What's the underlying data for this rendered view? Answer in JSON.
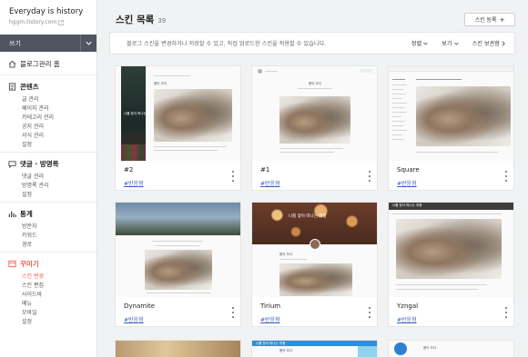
{
  "blog": {
    "title": "Everyday is history",
    "url": "hggm.tistory.com"
  },
  "sidebar": {
    "write_label": "쓰기",
    "home_label": "블로그관리 홈",
    "sections": [
      {
        "title": "콘텐츠",
        "items": [
          "글 관리",
          "페이지 관리",
          "카테고리 관리",
          "공지 관리",
          "서식 관리",
          "설정"
        ]
      },
      {
        "title": "댓글 · 방명록",
        "items": [
          "댓글 관리",
          "방명록 관리",
          "설정"
        ]
      },
      {
        "title": "통계",
        "items": [
          "방문자",
          "키워드",
          "경로"
        ]
      },
      {
        "title": "꾸미기",
        "items": [
          "스킨 변경",
          "스킨 편집",
          "사이드바",
          "메뉴",
          "모바일",
          "설정"
        ]
      }
    ]
  },
  "header": {
    "title": "스킨 목록",
    "count": "39",
    "register_label": "스킨 등록"
  },
  "notice": {
    "text": "블로그 스킨을 변경하거나 저장할 수 있고, 직접 업로드한 스킨을 적용할 수 있습니다.",
    "sort_label": "정렬",
    "view_label": "보기",
    "storage_label": "스킨 보관함"
  },
  "cards": [
    {
      "name": "#2",
      "tag": "#반응형",
      "thumb_title": "나를 찾아 떠나는 여행",
      "thumb_heading": "봄이 오다"
    },
    {
      "name": "#1",
      "tag": "#반응형",
      "thumb_heading": "봄이 오다"
    },
    {
      "name": "Square",
      "tag": "#반응형"
    },
    {
      "name": "Dynamite",
      "tag": "#반응형"
    },
    {
      "name": "Tirium",
      "tag": "#반응형",
      "thumb_title": "나를 찾아 떠나는 여행",
      "thumb_heading": "봄이 오다"
    },
    {
      "name": "Yzngal",
      "tag": "#반응형",
      "thumb_title": "나를 찾아 떠나는 여행"
    }
  ],
  "partial_cards": [
    {
      "thumb_title": ""
    },
    {
      "thumb_title": "나를 찾아 떠나는 여행",
      "thumb_heading": "봄이 오다"
    },
    {
      "thumb_heading": "봄이 오다"
    }
  ],
  "colors": {
    "accent": "#ff5544",
    "write_bar": "#4f5561",
    "tag_link": "#3a5fc2"
  }
}
